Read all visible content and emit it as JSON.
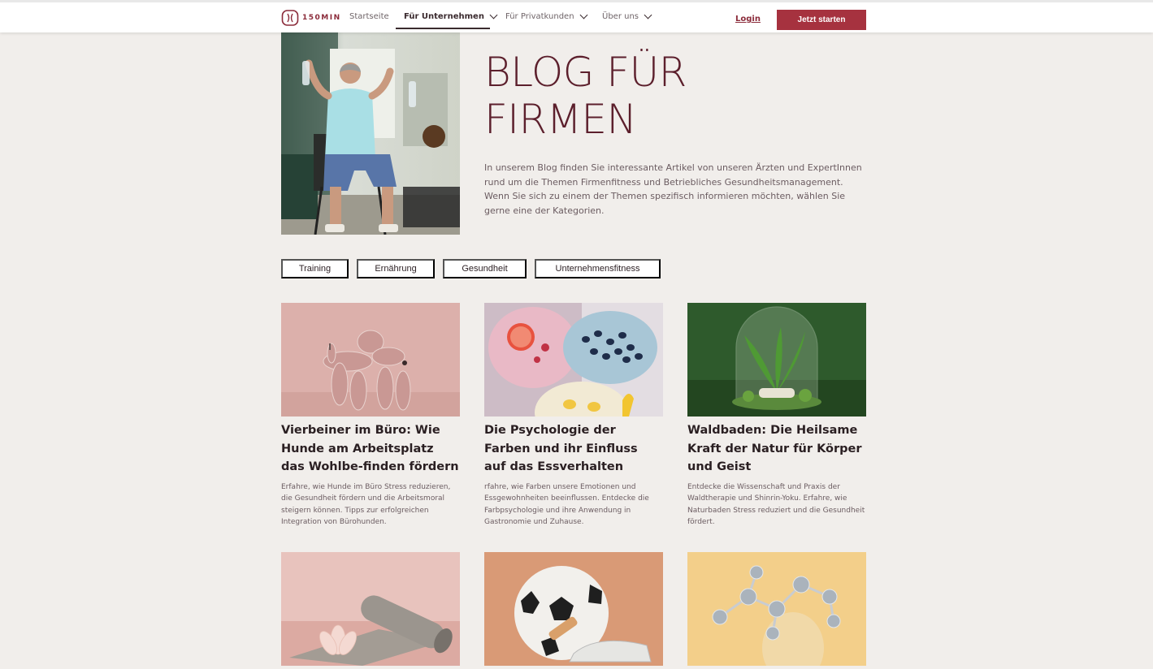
{
  "brand": {
    "logo_text": "150MIN",
    "accent": "#a6323f",
    "title_color": "#5c1f2c",
    "background": "#f1eeeb"
  },
  "nav": {
    "items": [
      {
        "label": "Startseite",
        "dropdown": false,
        "active": false
      },
      {
        "label": "Für Unternehmen",
        "dropdown": true,
        "active": true
      },
      {
        "label": "Für Privatkunden",
        "dropdown": true,
        "active": false
      },
      {
        "label": "Über uns",
        "dropdown": true,
        "active": false
      }
    ],
    "login": "Login",
    "cta": "Jetzt starten"
  },
  "hero": {
    "title_line1": "BLOG FÜR",
    "title_line2": "FIRMEN",
    "text": "In unserem Blog finden Sie interessante Artikel von unseren Ärzten und ExpertInnen rund um die Themen Firmenfitness und Betriebliches Gesundheitsmanagement. Wenn Sie sich zu einem der Themen spezifisch informieren möchten, wählen Sie gerne eine der Kategorien."
  },
  "categories": [
    "Training",
    "Ernährung",
    "Gesundheit",
    "Unternehmensfitness"
  ],
  "articles": [
    {
      "title": "Vierbeiner im Büro: Wie Hunde am Arbeitsplatz das Wohlbe-finden fördern",
      "desc": "Erfahre, wie Hunde im Büro Stress reduzieren, die Gesundheit fördern und die Arbeitsmoral steigern können. Tipps zur erfolgreichen Integration von Bürohunden."
    },
    {
      "title": "Die Psychologie der Farben und ihr Einfluss auf das Essverhalten",
      "desc": "rfahre, wie Farben unsere Emotionen und Essgewohnheiten beeinflussen. Entdecke die Farbpsychologie und ihre Anwendung in Gastronomie und Zuhause."
    },
    {
      "title": "Waldbaden: Die Heilsame Kraft der Natur für Körper und Geist",
      "desc": "Entdecke die Wissenschaft und Praxis der Waldtherapie und Shinrin-Yoku. Erfahre, wie Naturbaden Stress reduziert und die Gesundheit fördert."
    }
  ]
}
